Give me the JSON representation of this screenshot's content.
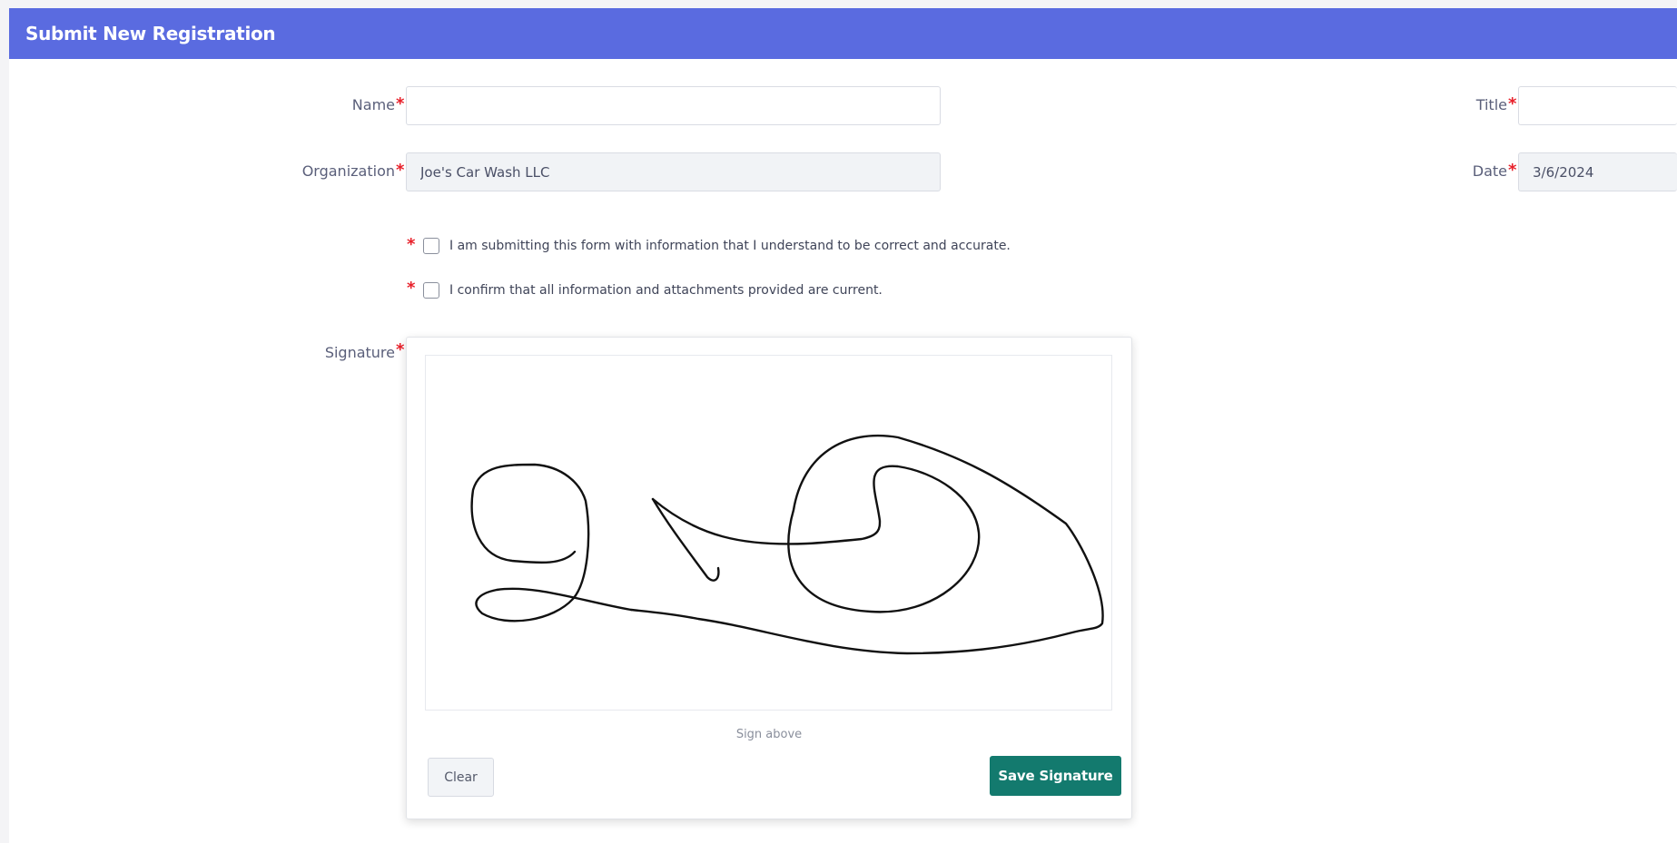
{
  "header": {
    "title": "Submit New Registration"
  },
  "colors": {
    "header_bg": "#5a6be0",
    "required_marker": "#e8202a",
    "save_button_bg": "#137a6e"
  },
  "form": {
    "required_marker": "*",
    "name": {
      "label": "Name",
      "value": "",
      "placeholder": ""
    },
    "title": {
      "label": "Title",
      "value": "",
      "placeholder": ""
    },
    "organization": {
      "label": "Organization",
      "value": "Joe's Car Wash LLC"
    },
    "date": {
      "label": "Date",
      "value": "3/6/2024"
    },
    "checkboxes": [
      {
        "label": "I am submitting this form with information that I understand to be correct and accurate.",
        "checked": false
      },
      {
        "label": "I confirm that all information and attachments provided are current.",
        "checked": false
      }
    ],
    "signature": {
      "label": "Signature",
      "hint": "Sign above",
      "clear_label": "Clear",
      "save_label": "Save Signature"
    }
  }
}
